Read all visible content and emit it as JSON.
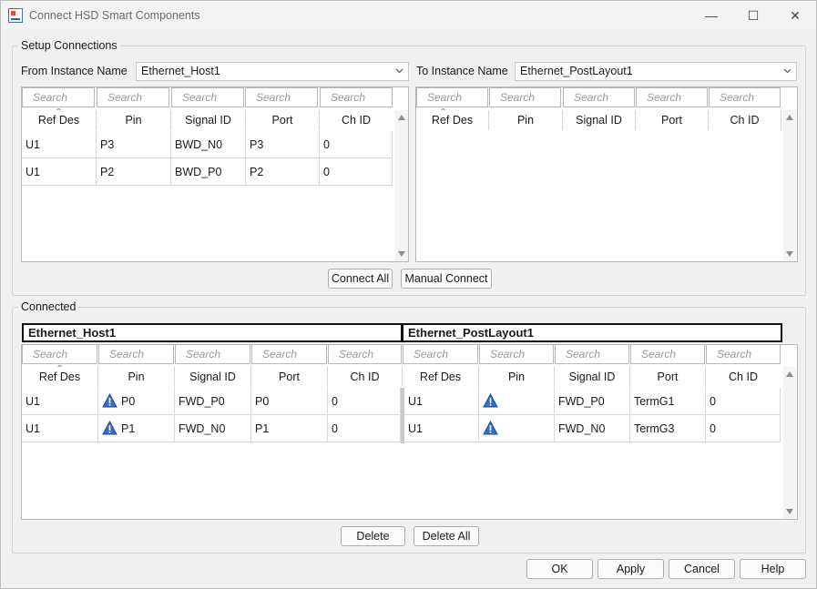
{
  "window": {
    "title": "Connect HSD Smart Components",
    "controls": {
      "minimize": "—",
      "maximize": "☐",
      "close": "✕"
    }
  },
  "setup": {
    "group_label": "Setup Connections",
    "from_label": "From Instance Name",
    "from_value": "Ethernet_Host1",
    "to_label": "To Instance Name",
    "to_value": "Ethernet_PostLayout1",
    "search_placeholder": "Search",
    "columns": [
      "Ref Des",
      "Pin",
      "Signal ID",
      "Port",
      "Ch ID"
    ],
    "from_rows": [
      [
        "U1",
        "P3",
        "BWD_N0",
        "P3",
        "0"
      ],
      [
        "U1",
        "P2",
        "BWD_P0",
        "P2",
        "0"
      ]
    ],
    "to_rows": [],
    "connect_all_label": "Connect All",
    "manual_connect_label": "Manual Connect"
  },
  "connected": {
    "group_label": "Connected",
    "left_instance": "Ethernet_Host1",
    "right_instance": "Ethernet_PostLayout1",
    "search_placeholder": "Search",
    "columns": [
      "Ref Des",
      "Pin",
      "Signal ID",
      "Port",
      "Ch ID"
    ],
    "left_rows": [
      {
        "refdes": "U1",
        "pin": "P0",
        "signal": "FWD_P0",
        "port": "P0",
        "ch": "0",
        "warning": true
      },
      {
        "refdes": "U1",
        "pin": "P1",
        "signal": "FWD_N0",
        "port": "P1",
        "ch": "0",
        "warning": true
      }
    ],
    "right_rows": [
      {
        "refdes": "U1",
        "pin": "",
        "signal": "FWD_P0",
        "port": "TermG1",
        "ch": "0",
        "warning": true
      },
      {
        "refdes": "U1",
        "pin": "",
        "signal": "FWD_N0",
        "port": "TermG3",
        "ch": "0",
        "warning": true
      }
    ],
    "delete_label": "Delete",
    "delete_all_label": "Delete All"
  },
  "footer": {
    "ok_label": "OK",
    "apply_label": "Apply",
    "cancel_label": "Cancel",
    "help_label": "Help"
  },
  "icons": {
    "warning": "warning-triangle-icon",
    "dropdown": "chevron-down-icon",
    "app": "app-icon"
  },
  "colors": {
    "warning_fill": "#2f6fd0",
    "window_bg": "#f0f0f0"
  }
}
